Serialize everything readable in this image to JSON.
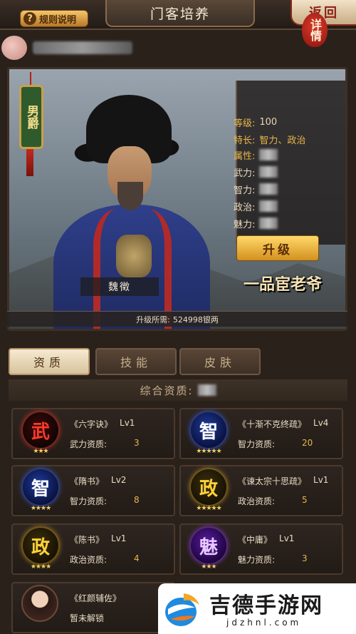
{
  "header": {
    "rules_label": "规则说明",
    "title": "门客培养",
    "back_label": "返回"
  },
  "hero": {
    "rank_tag": "男爵",
    "name": "魏徵",
    "detail_label": "详情",
    "stats": {
      "level_label": "等级:",
      "level_value": "100",
      "specialty_label": "特长:",
      "specialty_value": "智力、政治",
      "attribute_label": "属性:",
      "force_label": "武力:",
      "intellect_label": "智力:",
      "politics_label": "政治:",
      "charm_label": "魅力:"
    },
    "upgrade_label": "升级",
    "title_stamp": "一品宦老爷",
    "cost_label": "升级所需:",
    "cost_value": "524998银两"
  },
  "tabs": [
    {
      "label": "资质",
      "active": true
    },
    {
      "label": "技能",
      "active": false
    },
    {
      "label": "皮肤",
      "active": false
    }
  ],
  "overall_label": "综合资质:",
  "skills": [
    {
      "glyph": "武",
      "color": "red",
      "stars": "★★★",
      "book": "《六字诀》",
      "level": "Lv1",
      "attr": "武力资质:",
      "value": "3"
    },
    {
      "glyph": "智",
      "color": "blue",
      "stars": "★★★★★",
      "book": "《十渐不克终疏》",
      "level": "Lv4",
      "attr": "智力资质:",
      "value": "20"
    },
    {
      "glyph": "智",
      "color": "blue",
      "stars": "★★★★",
      "book": "《隋书》",
      "level": "Lv2",
      "attr": "智力资质:",
      "value": "8"
    },
    {
      "glyph": "政",
      "color": "gold",
      "stars": "★★★★★",
      "book": "《谏太宗十思疏》",
      "level": "Lv1",
      "attr": "政治资质:",
      "value": "5"
    },
    {
      "glyph": "政",
      "color": "gold",
      "stars": "★★★★",
      "book": "《陈书》",
      "level": "Lv1",
      "attr": "政治资质:",
      "value": "4"
    },
    {
      "glyph": "魅",
      "color": "purple",
      "stars": "★★★",
      "book": "《中庸》",
      "level": "Lv1",
      "attr": "魅力资质:",
      "value": "3"
    }
  ],
  "locked_skill": {
    "book": "《红颜辅佐》",
    "status": "暂未解锁"
  },
  "watermark": {
    "text": "吉德手游网",
    "url": "jdzhnl.com"
  }
}
